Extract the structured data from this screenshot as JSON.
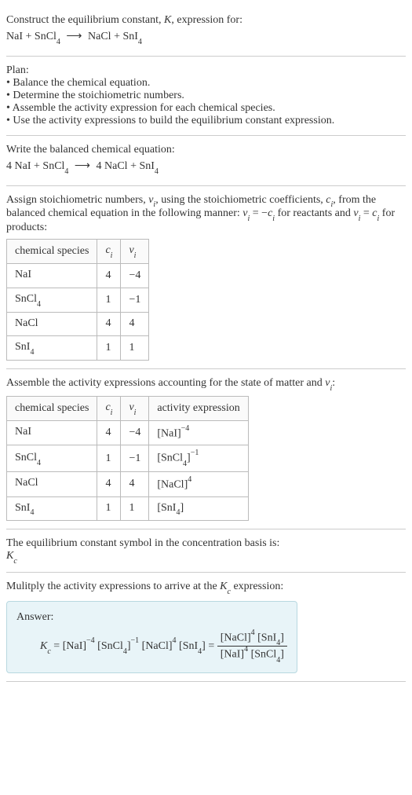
{
  "intro": {
    "line1": "Construct the equilibrium constant, ",
    "K": "K",
    "line1b": ", expression for:"
  },
  "reaction_unbalanced": {
    "r1": "NaI",
    "plus": " + ",
    "r2": "SnCl",
    "r2sub": "4",
    "arrow": "⟶",
    "p1": "NaCl",
    "p2": "SnI",
    "p2sub": "4"
  },
  "plan": {
    "heading": "Plan:",
    "b1": "• Balance the chemical equation.",
    "b2": "• Determine the stoichiometric numbers.",
    "b3": "• Assemble the activity expression for each chemical species.",
    "b4": "• Use the activity expressions to build the equilibrium constant expression."
  },
  "balanced": {
    "heading": "Write the balanced chemical equation:",
    "c1": "4",
    "r1": "NaI",
    "plus": " + ",
    "r2": "SnCl",
    "r2sub": "4",
    "arrow": "⟶",
    "c3": "4",
    "p1": "NaCl",
    "p2": "SnI",
    "p2sub": "4"
  },
  "stoich": {
    "text1": "Assign stoichiometric numbers, ",
    "nu": "ν",
    "isub": "i",
    "text2": ", using the stoichiometric coefficients, ",
    "c": "c",
    "text3": ", from the balanced chemical equation in the following manner: ",
    "eq1a": "ν",
    "eq1b": " = −",
    "eq1c": "c",
    "text4": " for reactants and ",
    "eq2a": "ν",
    "eq2b": " = ",
    "eq2c": "c",
    "text5": " for products:",
    "headers": {
      "species": "chemical species",
      "ci": "c",
      "cisub": "i",
      "nui": "ν",
      "nuisub": "i"
    },
    "rows": [
      {
        "species": "NaI",
        "sub": "",
        "ci": "4",
        "nui": "−4"
      },
      {
        "species": "SnCl",
        "sub": "4",
        "ci": "1",
        "nui": "−1"
      },
      {
        "species": "NaCl",
        "sub": "",
        "ci": "4",
        "nui": "4"
      },
      {
        "species": "SnI",
        "sub": "4",
        "ci": "1",
        "nui": "1"
      }
    ]
  },
  "activity": {
    "text": "Assemble the activity expressions accounting for the state of matter and ",
    "nu": "ν",
    "isub": "i",
    "colon": ":",
    "headers": {
      "species": "chemical species",
      "ci": "c",
      "cisub": "i",
      "nui": "ν",
      "nuisub": "i",
      "act": "activity expression"
    },
    "rows": [
      {
        "species": "NaI",
        "sub": "",
        "ci": "4",
        "nui": "−4",
        "act_base": "[NaI]",
        "act_sub": "",
        "act_exp": "−4"
      },
      {
        "species": "SnCl",
        "sub": "4",
        "ci": "1",
        "nui": "−1",
        "act_base": "[SnCl",
        "act_sub": "4",
        "act_close": "]",
        "act_exp": "−1"
      },
      {
        "species": "NaCl",
        "sub": "",
        "ci": "4",
        "nui": "4",
        "act_base": "[NaCl]",
        "act_sub": "",
        "act_exp": "4"
      },
      {
        "species": "SnI",
        "sub": "4",
        "ci": "1",
        "nui": "1",
        "act_base": "[SnI",
        "act_sub": "4",
        "act_close": "]",
        "act_exp": ""
      }
    ]
  },
  "symbol": {
    "text": "The equilibrium constant symbol in the concentration basis is:",
    "K": "K",
    "csub": "c"
  },
  "multiply": {
    "text1": "Mulitply the activity expressions to arrive at the ",
    "K": "K",
    "csub": "c",
    "text2": " expression:"
  },
  "answer": {
    "label": "Answer:",
    "Kc": "K",
    "Kcsub": "c",
    "eq": " = ",
    "t1": "[NaI]",
    "t1exp": "−4",
    "t2": "[SnCl",
    "t2sub": "4",
    "t2close": "]",
    "t2exp": "−1",
    "t3": "[NaCl]",
    "t3exp": "4",
    "t4": "[SnI",
    "t4sub": "4",
    "t4close": "]",
    "eq2": " = ",
    "num1": "[NaCl]",
    "num1exp": "4",
    "num2": "[SnI",
    "num2sub": "4",
    "num2close": "]",
    "den1": "[NaI]",
    "den1exp": "4",
    "den2": "[SnCl",
    "den2sub": "4",
    "den2close": "]"
  }
}
